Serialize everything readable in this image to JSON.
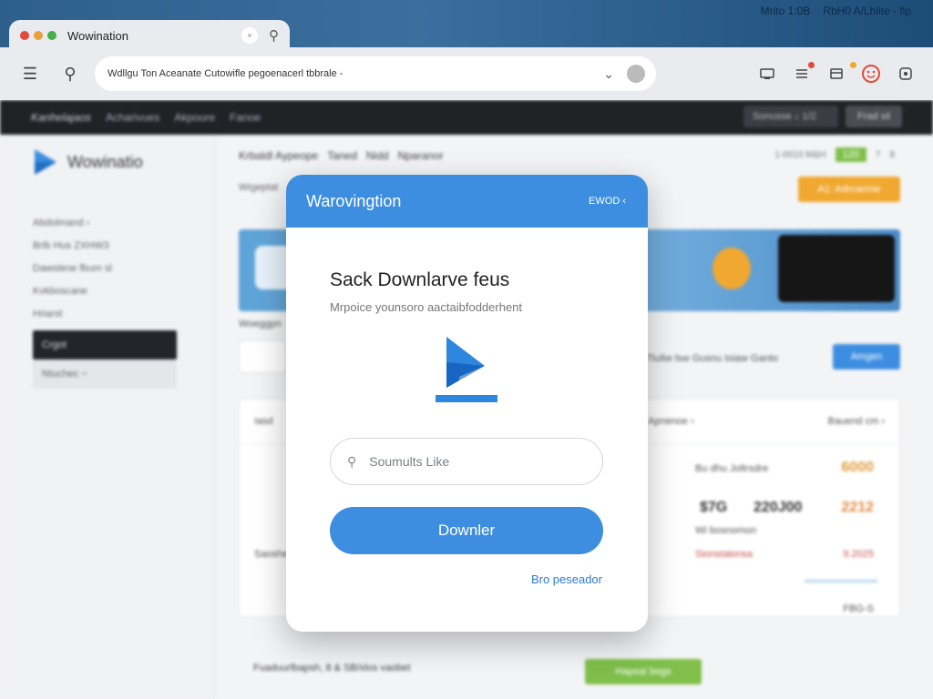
{
  "system_bar": {
    "left": "Mrito 1:0B",
    "right": "RbH0 A/Lhlite - flp"
  },
  "browser": {
    "tab_title": "Wowination",
    "tab_close": "×",
    "address_text": "Wdllgu Ton Aceanate Cutowifle pegoenacerl tbbrale -",
    "traffic_light_colors": [
      "#e24b3c",
      "#e9a13a",
      "#44b04a"
    ],
    "toolbar_icons": [
      "menu-icon",
      "search-icon"
    ],
    "extension_icons": [
      "cast-icon",
      "filter-icon",
      "reader-icon",
      "profile-icon",
      "extension-icon"
    ]
  },
  "site": {
    "nav": [
      "Kanhelajaos",
      "Acharivues",
      "Akpoure",
      "Fanoe"
    ],
    "nav_select": "Sonusse ↓ 1/2",
    "nav_button": "Frad sil",
    "logo_text": "Wowinatio",
    "sidebar": [
      {
        "label": "Abdolmand ›",
        "state": "normal"
      },
      {
        "label": "Brlb Hus ZXHW3",
        "state": "normal"
      },
      {
        "label": "Dawslene fbum sl",
        "state": "normal"
      },
      {
        "label": "Kvkboscane",
        "state": "normal"
      },
      {
        "label": "Hriarst",
        "state": "normal"
      },
      {
        "label": "Crgot",
        "state": "active"
      },
      {
        "label": "Ntuchec ~",
        "state": "sub"
      }
    ],
    "breadcrumb": [
      "Krbaldl Aypeope",
      "Taned",
      "Nidd",
      "Nparanor"
    ],
    "sub_breadcrumb": "Wigeptat",
    "pager": [
      "1-0010 M&H",
      "120",
      "7",
      "8"
    ],
    "action_button": "A1: Adrcanme",
    "section_label": "Woeggpn",
    "filter_text": "Tiuliw lsw Gusnu Ioiaw Ganto",
    "filter_button": "Amgen",
    "table_header_left": "Iasd",
    "table_header_right": "Apnenoe ›",
    "table_header_far": "Bauend cm ›",
    "rows": [
      {
        "text": "Bu  dhu  Joltrsdre",
        "value": "6000",
        "value_color": "#e09a3c"
      },
      {
        "text": "Wi bosnomon",
        "a": "$7G",
        "b": "220J00",
        "value": "2212",
        "value_color": "#e0883c"
      },
      {
        "text": "Saoshelooo",
        "b_sub": "Sionstalonsa",
        "value_sub": "9.2025"
      }
    ],
    "footer_text": "Fuaduurlbapsh, 8 & SB/xlos vaobet",
    "footer_button": "Hapsai bogs",
    "footer_tag": "FBG-S"
  },
  "modal": {
    "header_title": "Warovingtion",
    "header_action": "EWOD ‹",
    "heading": "Sack Downlarve feus",
    "subtext": "Mrpoice younsoro aactaibfodderhent",
    "search_placeholder": "Soumults Like",
    "primary_button": "Downler",
    "link": "Bro peseador",
    "accent": "#3d8ee0"
  }
}
